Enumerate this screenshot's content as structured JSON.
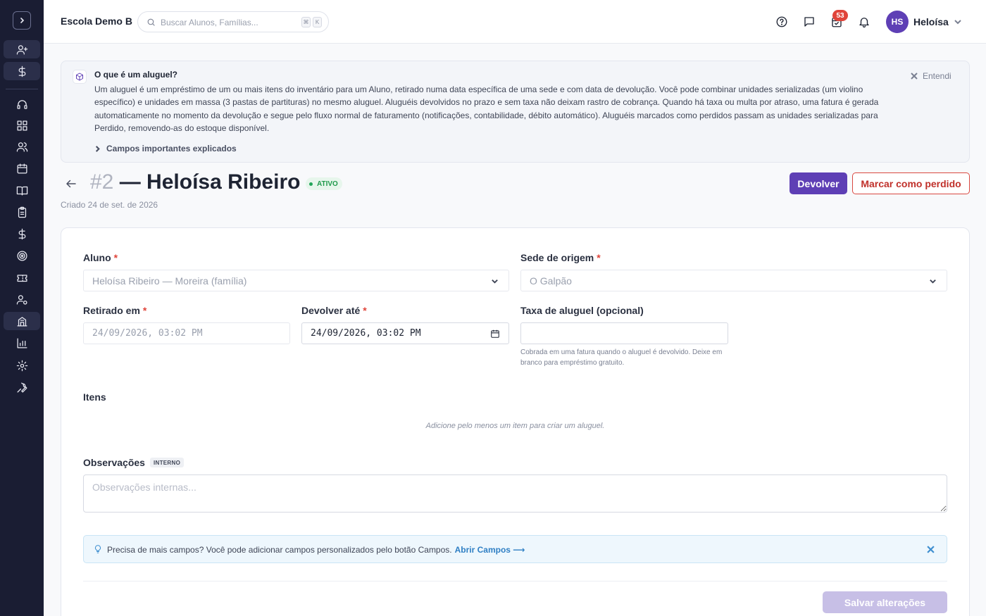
{
  "app": {
    "school_name": "Escola Demo B",
    "search_placeholder": "Buscar Alunos, Famílias...",
    "search_kbd_1": "⌘",
    "search_kbd_2": "K",
    "notifications_badge": "53",
    "user_initials": "HS",
    "user_name": "Heloísa"
  },
  "sidebar": {
    "icons": [
      "chevron-right-icon",
      "user-plus-icon",
      "dollar-icon",
      "headset-icon",
      "dashboard-icon",
      "users-icon",
      "calendar-icon",
      "book-icon",
      "clipboard-icon",
      "dollar-icon",
      "target-icon",
      "ticket-icon",
      "user-settings-icon",
      "rentals-icon",
      "bar-chart-icon",
      "gear-icon",
      "wrench-icon"
    ]
  },
  "info": {
    "title": "O que é um aluguel?",
    "body": "Um aluguel é um empréstimo de um ou mais itens do inventário para um Aluno, retirado numa data específica de uma sede e com data de devolução. Você pode combinar unidades serializadas (um violino específico) e unidades em massa (3 pastas de partituras) no mesmo aluguel. Aluguéis devolvidos no prazo e sem taxa não deixam rastro de cobrança. Quando há taxa ou multa por atraso, uma fatura é gerada automaticamente no momento da devolução e segue pelo fluxo normal de faturamento (notificações, contabilidade, débito automático). Aluguéis marcados como perdidos passam as unidades serializadas para Perdido, removendo-as do estoque disponível.",
    "dismiss_label": "Entendi",
    "expand_label": "Campos importantes explicados"
  },
  "header": {
    "number": "#2",
    "title": "— Heloísa Ribeiro",
    "status": "ATIVO",
    "created": "Criado 24 de set. de 2026",
    "return_button": "Devolver",
    "lost_button": "Marcar como perdido"
  },
  "form": {
    "student_label": "Aluno",
    "student_value": "Heloísa Ribeiro — Moreira (família)",
    "location_label": "Sede de origem",
    "location_value": "O Galpão",
    "checkout_label": "Retirado em",
    "checkout_value": "24/09/2026, 03:02 PM",
    "due_label": "Devolver até",
    "due_value": "24/09/2026, 03:02 PM",
    "fee_label": "Taxa de aluguel (opcional)",
    "fee_value": "",
    "fee_help": "Cobrada em uma fatura quando o aluguel é devolvido. Deixe em branco para empréstimo gratuito.",
    "items_label": "Itens",
    "items_empty": "Adicione pelo menos um item para criar um aluguel.",
    "notes_label": "Observações",
    "notes_badge": "INTERNO",
    "notes_placeholder": "Observações internas...",
    "tip_text": "Precisa de mais campos? Você pode adicionar campos personalizados pelo botão Campos.",
    "tip_link": "Abrir Campos ⟶",
    "save_button": "Salvar alterações"
  },
  "colors": {
    "primary": "#5e3fb5",
    "danger": "#c0302a",
    "success": "#1f9a4b",
    "sidebar": "#1a1d33"
  }
}
